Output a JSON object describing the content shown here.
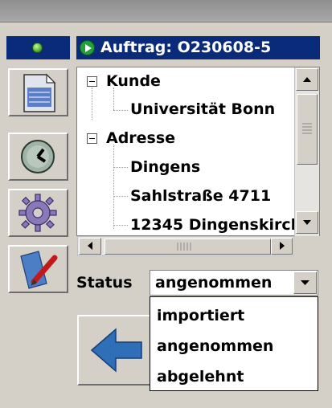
{
  "header": {
    "title": "Auftrag: O230608-5"
  },
  "sidebar": {
    "buttons": [
      {
        "icon": "document-icon"
      },
      {
        "icon": "clock-icon"
      },
      {
        "icon": "gear-icon"
      },
      {
        "icon": "edit-pen-icon"
      }
    ]
  },
  "tree": {
    "nodes": [
      {
        "label": "Kunde",
        "expanded": true
      },
      {
        "label": "Universität Bonn"
      },
      {
        "label": "Adresse",
        "expanded": true
      },
      {
        "label": "Dingens"
      },
      {
        "label": "Sahlstraße 4711"
      },
      {
        "label": "12345 Dingenskirch"
      }
    ]
  },
  "status": {
    "label": "Status",
    "selected": "angenommen",
    "options": [
      "importiert",
      "angenommen",
      "abgelehnt"
    ]
  },
  "colors": {
    "header_bg": "#0a2a7a",
    "led_green": "#3fa021",
    "back_arrow": "#2e6fb8"
  }
}
